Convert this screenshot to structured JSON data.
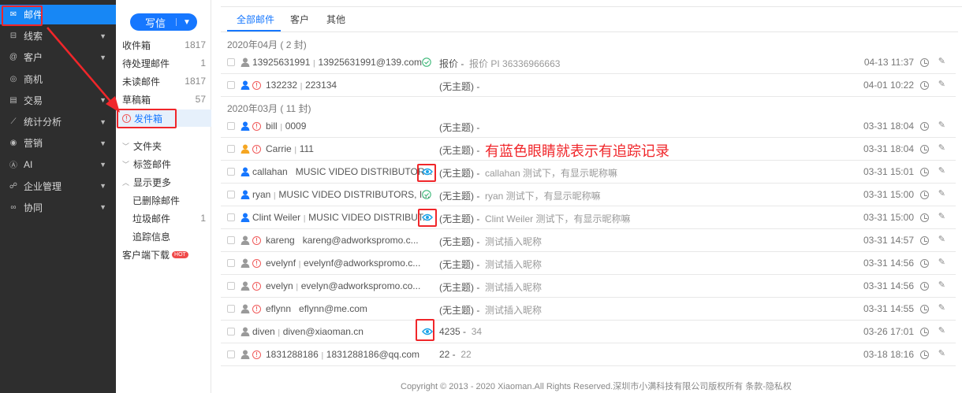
{
  "nav": [
    {
      "label": "邮件",
      "icon": "mail-icon",
      "sym": "✉",
      "active": true,
      "chev": false
    },
    {
      "label": "线索",
      "icon": "leads-icon",
      "sym": "⊟",
      "chev": true
    },
    {
      "label": "客户",
      "icon": "customer-icon",
      "sym": "@",
      "chev": true
    },
    {
      "label": "商机",
      "icon": "opportunity-icon",
      "sym": "◎",
      "chev": false
    },
    {
      "label": "交易",
      "icon": "deal-icon",
      "sym": "▤",
      "chev": true
    },
    {
      "label": "统计分析",
      "icon": "chart-icon",
      "sym": "⟋",
      "chev": true
    },
    {
      "label": "营销",
      "icon": "marketing-icon",
      "sym": "◉",
      "chev": true
    },
    {
      "label": "AI",
      "icon": "ai-icon",
      "sym": "Ⓐ",
      "chev": true
    },
    {
      "label": "企业管理",
      "icon": "org-icon",
      "sym": "☍",
      "chev": true
    },
    {
      "label": "协同",
      "icon": "collab-icon",
      "sym": "∞",
      "chev": true
    }
  ],
  "compose": {
    "label": "写信"
  },
  "folders": {
    "inbox": {
      "label": "收件箱",
      "count": "1817"
    },
    "pending": {
      "label": "待处理邮件",
      "count": "1"
    },
    "unread": {
      "label": "未读邮件",
      "count": "1817"
    },
    "drafts": {
      "label": "草稿箱",
      "count": "57"
    },
    "outbox": {
      "label": "发件箱"
    },
    "folder": {
      "label": "文件夹"
    },
    "tagged": {
      "label": "标签邮件"
    },
    "more": {
      "label": "显示更多"
    },
    "deleted": {
      "label": "已删除邮件"
    },
    "spam": {
      "label": "垃圾邮件",
      "count": "1"
    },
    "tracking": {
      "label": "追踪信息"
    },
    "download": {
      "label": "客户端下载",
      "badge": "HOT"
    }
  },
  "tabs": [
    "全部邮件",
    "客户",
    "其他"
  ],
  "groups": [
    {
      "header": "2020年04月 ( 2 封)",
      "rows": [
        {
          "name": "13925631991",
          "addr": "13925631991@139.com",
          "person": "gray",
          "alert": false,
          "status": "check",
          "subject": "报价 -",
          "preview": "报价 PI 36336966663",
          "time": "04-13 11:37"
        },
        {
          "name": "132232",
          "addr": "223134",
          "person": "blue",
          "alert": true,
          "status": "",
          "subject": "(无主题) -",
          "preview": "",
          "time": "04-01 10:22"
        }
      ]
    },
    {
      "header": "2020年03月 ( 11 封)",
      "rows": [
        {
          "name": "bill",
          "addr": "0009",
          "person": "blue",
          "alert": true,
          "status": "",
          "subject": "(无主题) -",
          "preview": "",
          "time": "03-31 18:04"
        },
        {
          "name": "Carrie",
          "addr": "111",
          "person": "orange",
          "alert": true,
          "status": "",
          "subject": "(无主题) -",
          "preview": "",
          "time": "03-31 18:04"
        },
        {
          "name": "callahan",
          "addr": "MUSIC VIDEO DISTRIBUTOR...",
          "person": "blue",
          "alert": false,
          "status": "eye",
          "subject": "(无主题) -",
          "preview": "callahan 测试下，有显示昵称嘛",
          "time": "03-31 15:01",
          "nosep": true
        },
        {
          "name": "ryan",
          "addr": "MUSIC VIDEO DISTRIBUTORS, I...",
          "person": "blue",
          "alert": false,
          "status": "check",
          "subject": "(无主题) -",
          "preview": "ryan 测试下，有显示昵称嘛",
          "time": "03-31 15:00"
        },
        {
          "name": "Clint Weiler",
          "addr": "MUSIC VIDEO DISTRIBUT...",
          "person": "blue",
          "alert": false,
          "status": "eye",
          "subject": "(无主题) -",
          "preview": "Clint Weiler 测试下，有显示昵称嘛",
          "time": "03-31 15:00"
        },
        {
          "name": "kareng",
          "addr": "kareng@adworkspromo.c...",
          "person": "gray",
          "alert": true,
          "status": "",
          "subject": "(无主题) -",
          "preview": "测试插入昵称",
          "time": "03-31 14:57",
          "nosep": true
        },
        {
          "name": "evelynf",
          "addr": "evelynf@adworkspromo.c...",
          "person": "gray",
          "alert": true,
          "status": "",
          "subject": "(无主题) -",
          "preview": "测试插入昵称",
          "time": "03-31 14:56"
        },
        {
          "name": "evelyn",
          "addr": "evelyn@adworkspromo.co...",
          "person": "gray",
          "alert": true,
          "status": "",
          "subject": "(无主题) -",
          "preview": "测试插入昵称",
          "time": "03-31 14:56"
        },
        {
          "name": "eflynn",
          "addr": "eflynn@me.com",
          "person": "gray",
          "alert": true,
          "status": "",
          "subject": "(无主题) -",
          "preview": "测试插入昵称",
          "time": "03-31 14:55",
          "nosep": true
        },
        {
          "name": "diven",
          "addr": "diven@xiaoman.cn",
          "person": "gray",
          "alert": false,
          "status": "eye",
          "subject": "4235 -",
          "preview": "34",
          "time": "03-26 17:01"
        },
        {
          "name": "1831288186",
          "addr": "1831288186@qq.com",
          "person": "gray",
          "alert": true,
          "status": "",
          "subject": "22 -",
          "preview": "22",
          "time": "03-18 18:16"
        }
      ]
    }
  ],
  "annotation": "有蓝色眼睛就表示有追踪记录",
  "footer": "Copyright © 2013 - 2020 Xiaoman.All Rights Reserved.深圳市小满科技有限公司版权所有 条款-隐私权",
  "colors": {
    "accent": "#1677ff",
    "annotation": "#f0262a",
    "nav_bg": "#2e2e2e",
    "person_blue": "#1677ff",
    "person_gray": "#9a9a9a",
    "person_orange": "#f5a623",
    "eye": "#1aa3e8",
    "check": "#3cb878"
  }
}
